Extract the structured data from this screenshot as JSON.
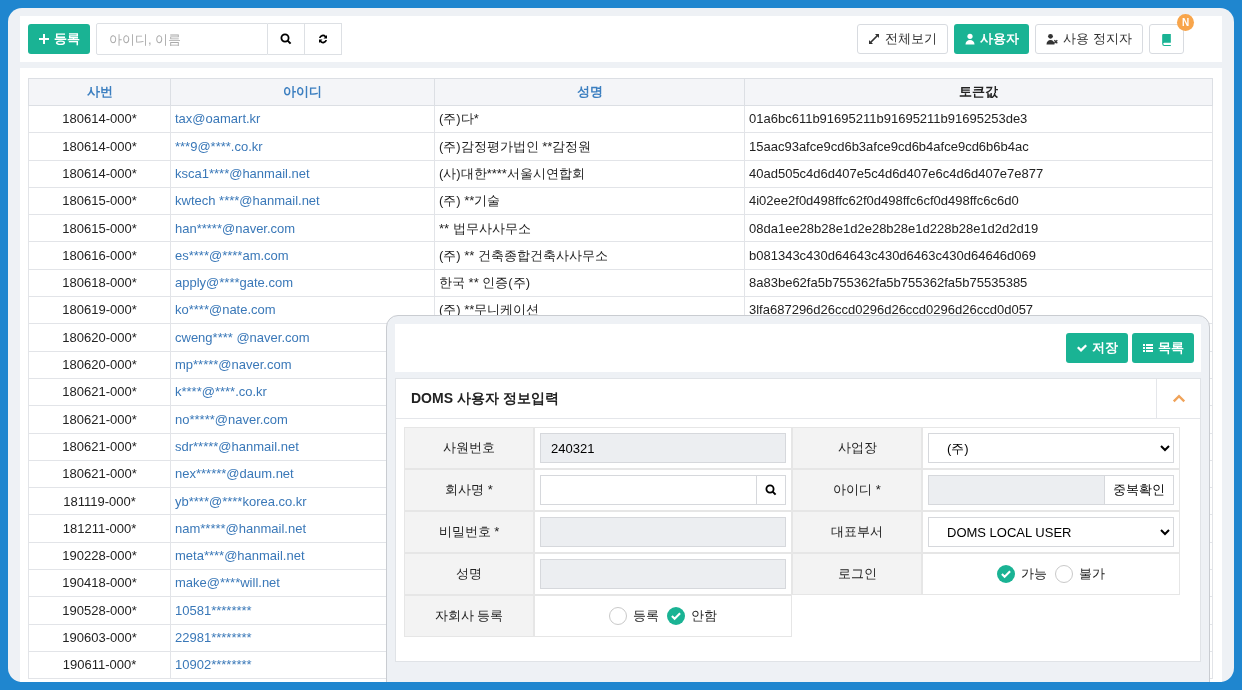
{
  "toolbar": {
    "add_button": "등록",
    "search": {
      "placeholder": "아이디, 이름"
    },
    "view_buttons": [
      {
        "label": "전체보기",
        "kind": "expand",
        "selected": false
      },
      {
        "label": "사용자",
        "kind": "user",
        "selected": true
      },
      {
        "label": "사용 정지자",
        "kind": "user-x",
        "selected": false
      }
    ],
    "notice_badge": "N"
  },
  "table": {
    "columns": [
      {
        "label": "사번",
        "sortable": true
      },
      {
        "label": "아이디",
        "sortable": true
      },
      {
        "label": "성명",
        "sortable": true
      },
      {
        "label": "토큰값",
        "sortable": false
      }
    ],
    "rows": [
      {
        "employee_no": "180614-000*",
        "user_id": "tax@oamart.kr",
        "name": "(주)다*",
        "token": "01a6bc611b91695211b91695211b91695253de3"
      },
      {
        "employee_no": "180614-000*",
        "user_id": "***9@****.co.kr",
        "name": "(주)감정평가법인  **감정원",
        "token": "15aac93afce9cd6b3afce9cd6b4afce9cd6b6b4ac"
      },
      {
        "employee_no": "180614-000*",
        "user_id": "ksca1****@hanmail.net",
        "name": "(사)대한****서울시연합회",
        "token": "40ad505c4d6d407e5c4d6d407e6c4d6d407e7e877"
      },
      {
        "employee_no": "180615-000*",
        "user_id": "kwtech ****@hanmail.net",
        "name": "(주) **기술",
        "token": "4i02ee2f0d498ffc62f0d498ffc6cf0d498ffc6c6d0"
      },
      {
        "employee_no": "180615-000*",
        "user_id": "han*****@naver.com",
        "name": " ** 법무사사무소",
        "token": "08da1ee28b28e1d2e28b28e1d228b28e1d2d2d19"
      },
      {
        "employee_no": "180616-000*",
        "user_id": "es****@****am.com",
        "name": "(주) ** 건축종합건축사사무소",
        "token": "b081343c430d64643c430d6463c430d64646d069"
      },
      {
        "employee_no": "180618-000*",
        "user_id": "apply@****gate.com",
        "name": "한국 ** 인증(주)",
        "token": "8a83be62fa5b755362fa5b755362fa5b75535385"
      },
      {
        "employee_no": "180619-000*",
        "user_id": "ko****@nate.com",
        "name": "(주) **무니케이션",
        "token": "3lfa687296d26ccd0296d26ccd0296d26ccd0d057"
      },
      {
        "employee_no": "180620-000*",
        "user_id": "cweng**** @naver.com"
      },
      {
        "employee_no": "180620-000*",
        "user_id": "mp*****@naver.com"
      },
      {
        "employee_no": "180621-000*",
        "user_id": "k****@****.co.kr"
      },
      {
        "employee_no": "180621-000*",
        "user_id": "no*****@naver.com"
      },
      {
        "employee_no": "180621-000*",
        "user_id": "sdr*****@hanmail.net"
      },
      {
        "employee_no": "180621-000*",
        "user_id": "nex******@daum.net"
      },
      {
        "employee_no": "181119-000*",
        "user_id": "yb****@****korea.co.kr"
      },
      {
        "employee_no": "181211-000*",
        "user_id": "nam*****@hanmail.net"
      },
      {
        "employee_no": "190228-000*",
        "user_id": "meta****@hanmail.net"
      },
      {
        "employee_no": "190418-000*",
        "user_id": "make@****will.net"
      },
      {
        "employee_no": "190528-000*",
        "user_id": "10581********"
      },
      {
        "employee_no": "190603-000*",
        "user_id": "22981********"
      },
      {
        "employee_no": "190611-000*",
        "user_id": "10902********"
      }
    ]
  },
  "form_panel": {
    "buttons": [
      {
        "label": "저장",
        "kind": "save"
      },
      {
        "label": "목록",
        "kind": "list"
      }
    ],
    "title": "DOMS 사용자 정보입력",
    "expanded": true,
    "fields": [
      {
        "label": "사원번호",
        "kind": "text",
        "value": "240321",
        "readonly": true
      },
      {
        "label": "사업장",
        "kind": "select",
        "value": "(주)"
      },
      {
        "label": "회사명 *",
        "kind": "search",
        "readonly": false
      },
      {
        "label": "아이디 *",
        "kind": "check",
        "button": "중복확인",
        "readonly": true
      },
      {
        "label": "비밀번호 *",
        "kind": "text",
        "readonly": true
      },
      {
        "label": "대표부서",
        "kind": "select",
        "value": "DOMS LOCAL USER"
      },
      {
        "label": "성명",
        "kind": "text",
        "readonly": true
      },
      {
        "label": "로그인",
        "kind": "radio",
        "options": [
          {
            "label": "가능",
            "selected": true
          },
          {
            "label": "불가",
            "selected": false
          }
        ]
      },
      {
        "label": "자회사 등록",
        "kind": "radio",
        "options": [
          {
            "label": "등록",
            "selected": false
          },
          {
            "label": "안함",
            "selected": true
          }
        ]
      }
    ]
  }
}
